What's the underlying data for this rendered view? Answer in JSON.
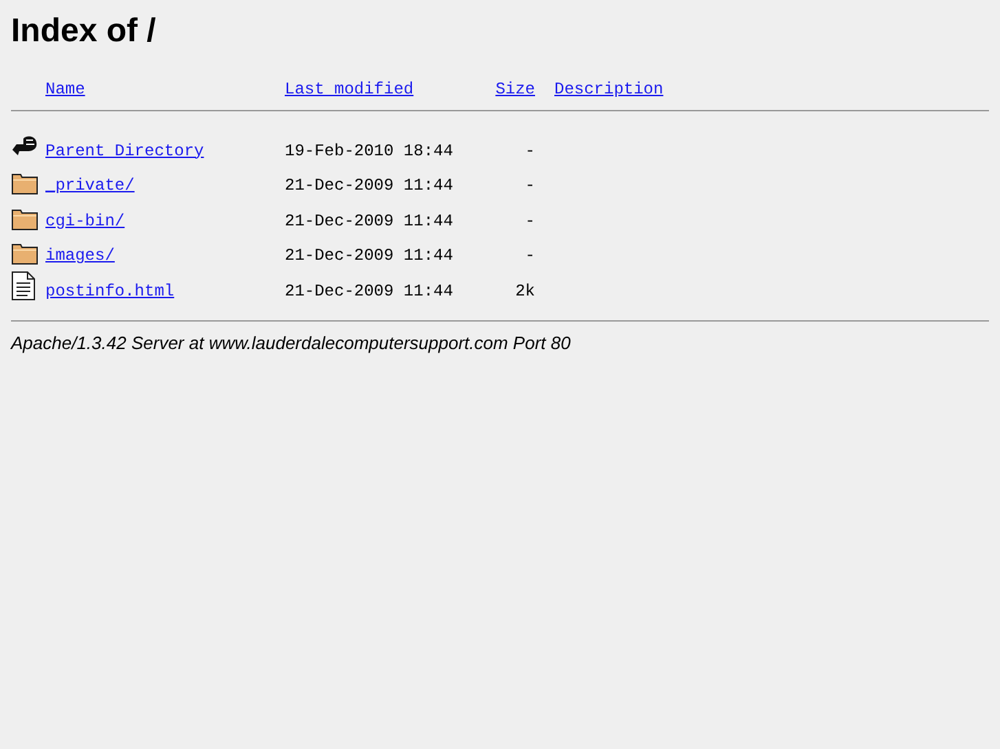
{
  "title": "Index of /",
  "columns": [
    "Name",
    "Last modified",
    "Size",
    "Description"
  ],
  "rows": [
    {
      "kind": "parent",
      "name": "Parent Directory",
      "modified": "19-Feb-2010 18:44",
      "size": "-"
    },
    {
      "kind": "folder",
      "name": "_private/",
      "modified": "21-Dec-2009 11:44",
      "size": "-"
    },
    {
      "kind": "folder",
      "name": "cgi-bin/",
      "modified": "21-Dec-2009 11:44",
      "size": "-"
    },
    {
      "kind": "folder",
      "name": "images/",
      "modified": "21-Dec-2009 11:44",
      "size": "-"
    },
    {
      "kind": "file",
      "name": "postinfo.html",
      "modified": "21-Dec-2009 11:44",
      "size": "2k"
    }
  ],
  "footer": "Apache/1.3.42 Server at www.lauderdalecomputersupport.com Port 80"
}
